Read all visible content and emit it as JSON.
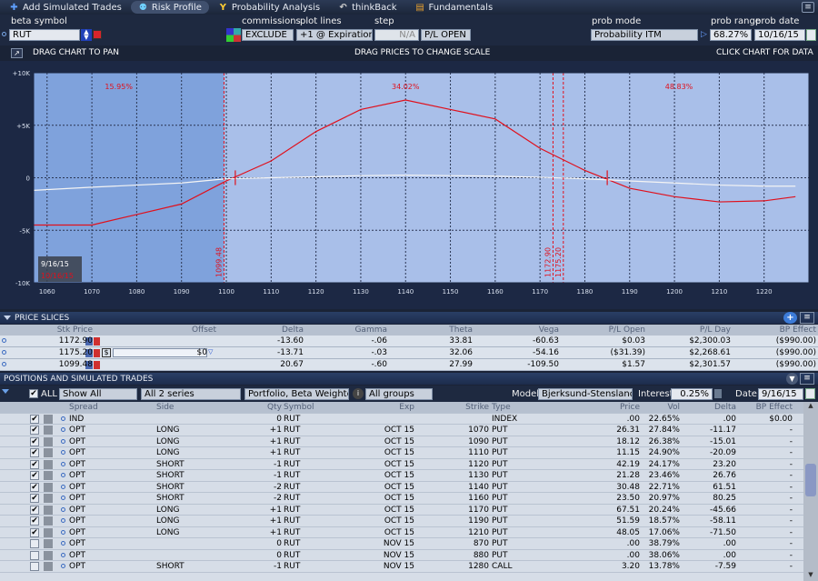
{
  "toolbar": {
    "tabs": [
      {
        "label": "Add Simulated Trades",
        "icon": "plus-icon"
      },
      {
        "label": "Risk Profile",
        "icon": "people-icon",
        "active": true
      },
      {
        "label": "Probability Analysis",
        "icon": "y-icon"
      },
      {
        "label": "thinkBack",
        "icon": "thinkback-icon"
      },
      {
        "label": "Fundamentals",
        "icon": "fundamentals-icon"
      }
    ]
  },
  "controls": {
    "beta_symbol_label": "beta symbol",
    "beta_symbol_value": "RUT",
    "commissions_label": "commissions",
    "commissions_value": "EXCLUDE",
    "plot_lines_label": "plot lines",
    "plot_lines_value": "+1 @ Expiration",
    "step_label": "step",
    "step_value": "N/A",
    "step_mode": "P/L OPEN",
    "prob_mode_label": "prob mode",
    "prob_mode_value": "Probability ITM",
    "prob_range_label": "prob range",
    "prob_range_value": "68.27%",
    "prob_date_label": "prob date",
    "prob_date_value": "10/16/15"
  },
  "chart_header": {
    "left": "DRAG CHART TO PAN",
    "center": "DRAG PRICES TO CHANGE SCALE",
    "right": "CLICK CHART FOR DATA"
  },
  "chart_data": {
    "type": "line",
    "x_ticks": [
      1060,
      1070,
      1080,
      1090,
      1100,
      1110,
      1120,
      1130,
      1140,
      1150,
      1160,
      1170,
      1180,
      1190,
      1200,
      1210,
      1220
    ],
    "y_ticks": [
      "+10K",
      "+5K",
      "0",
      "-5K",
      "-10K"
    ],
    "xlim": [
      1057,
      1230
    ],
    "ylim": [
      -10000,
      10000
    ],
    "series": [
      {
        "name": "",
        "color": "#e0101c",
        "x": [
          1057,
          1070,
          1080,
          1090,
          1100,
          1110,
          1120,
          1130,
          1140,
          1150,
          1160,
          1170,
          1180,
          1190,
          1200,
          1210,
          1220,
          1227
        ],
        "y": [
          -4500,
          -4500,
          -3500,
          -2500,
          -300,
          1600,
          4400,
          6500,
          7400,
          6500,
          5600,
          2800,
          700,
          -1000,
          -1800,
          -2300,
          -2200,
          -1800
        ]
      },
      {
        "name": "",
        "color": "#f4f4f4",
        "x": [
          1057,
          1070,
          1080,
          1090,
          1100,
          1110,
          1120,
          1130,
          1140,
          1150,
          1160,
          1170,
          1180,
          1190,
          1200,
          1210,
          1220,
          1227
        ],
        "y": [
          -1200,
          -900,
          -700,
          -500,
          -100,
          0,
          100,
          200,
          250,
          200,
          150,
          50,
          -100,
          -300,
          -500,
          -700,
          -800,
          -800
        ]
      }
    ],
    "prob_labels": [
      "15.95%",
      "34.02%",
      "48.83%"
    ],
    "vlines": [
      {
        "x": 1099.48,
        "label": "1099.48"
      },
      {
        "x": 1172.9,
        "label": "1172.90"
      },
      {
        "x": 1175.2,
        "label": "1175.20"
      }
    ],
    "shaded_x_max": 1099.48,
    "date_label_1": "9/16/15",
    "date_label_2": "10/16/15"
  },
  "price_slices": {
    "title": "PRICE SLICES",
    "columns": [
      "Stk Price",
      "Offset",
      "Delta",
      "Gamma",
      "Theta",
      "Vega",
      "P/L Open",
      "P/L Day",
      "BP Effect"
    ],
    "rows": [
      [
        "1172.90",
        "",
        "-13.60",
        "-.06",
        "33.81",
        "-60.63",
        "$0.03",
        "$2,300.03",
        "($990.00)"
      ],
      [
        "1175.20",
        "$0",
        "-13.71",
        "-.03",
        "32.06",
        "-54.16",
        "($31.39)",
        "$2,268.61",
        "($990.00)"
      ],
      [
        "1099.48",
        "",
        "20.67",
        "-.60",
        "27.99",
        "-109.50",
        "$1.57",
        "$2,301.57",
        "($990.00)"
      ]
    ]
  },
  "positions": {
    "title": "POSITIONS AND SIMULATED TRADES",
    "all_label": "ALL",
    "show_filter": "Show All",
    "series_filter": "All 2 series",
    "weighting": "Portfolio, Beta Weighted",
    "groups": "All groups",
    "model_label": "Model",
    "model_value": "Bjerksund-Stensland",
    "interest_label": "Interest",
    "interest_value": "0.25%",
    "date_label": "Date",
    "date_value": "9/16/15",
    "columns": [
      "Spread",
      "Side",
      "Qty",
      "Symbol",
      "Exp",
      "Strike",
      "Type",
      "Price",
      "Vol",
      "Delta",
      "BP Effect"
    ],
    "rows": [
      {
        "checked": true,
        "spread": "IND",
        "side": "",
        "qty": "0",
        "sym": "RUT",
        "exp": "",
        "strike": "",
        "type": "INDEX",
        "price": ".00",
        "vol": "22.65%",
        "delta": ".00",
        "bp": "$0.00"
      },
      {
        "checked": true,
        "spread": "OPT",
        "side": "LONG",
        "qty": "+1",
        "sym": "RUT",
        "exp": "OCT 15",
        "strike": "1070",
        "type": "PUT",
        "price": "26.31",
        "vol": "27.84%",
        "delta": "-11.17",
        "bp": "-"
      },
      {
        "checked": true,
        "spread": "OPT",
        "side": "LONG",
        "qty": "+1",
        "sym": "RUT",
        "exp": "OCT 15",
        "strike": "1090",
        "type": "PUT",
        "price": "18.12",
        "vol": "26.38%",
        "delta": "-15.01",
        "bp": "-"
      },
      {
        "checked": true,
        "spread": "OPT",
        "side": "LONG",
        "qty": "+1",
        "sym": "RUT",
        "exp": "OCT 15",
        "strike": "1110",
        "type": "PUT",
        "price": "11.15",
        "vol": "24.90%",
        "delta": "-20.09",
        "bp": "-"
      },
      {
        "checked": true,
        "spread": "OPT",
        "side": "SHORT",
        "qty": "-1",
        "sym": "RUT",
        "exp": "OCT 15",
        "strike": "1120",
        "type": "PUT",
        "price": "42.19",
        "vol": "24.17%",
        "delta": "23.20",
        "bp": "-"
      },
      {
        "checked": true,
        "spread": "OPT",
        "side": "SHORT",
        "qty": "-1",
        "sym": "RUT",
        "exp": "OCT 15",
        "strike": "1130",
        "type": "PUT",
        "price": "21.28",
        "vol": "23.46%",
        "delta": "26.76",
        "bp": "-"
      },
      {
        "checked": true,
        "spread": "OPT",
        "side": "SHORT",
        "qty": "-2",
        "sym": "RUT",
        "exp": "OCT 15",
        "strike": "1140",
        "type": "PUT",
        "price": "30.48",
        "vol": "22.71%",
        "delta": "61.51",
        "bp": "-"
      },
      {
        "checked": true,
        "spread": "OPT",
        "side": "SHORT",
        "qty": "-2",
        "sym": "RUT",
        "exp": "OCT 15",
        "strike": "1160",
        "type": "PUT",
        "price": "23.50",
        "vol": "20.97%",
        "delta": "80.25",
        "bp": "-"
      },
      {
        "checked": true,
        "spread": "OPT",
        "side": "LONG",
        "qty": "+1",
        "sym": "RUT",
        "exp": "OCT 15",
        "strike": "1170",
        "type": "PUT",
        "price": "67.51",
        "vol": "20.24%",
        "delta": "-45.66",
        "bp": "-"
      },
      {
        "checked": true,
        "spread": "OPT",
        "side": "LONG",
        "qty": "+1",
        "sym": "RUT",
        "exp": "OCT 15",
        "strike": "1190",
        "type": "PUT",
        "price": "51.59",
        "vol": "18.57%",
        "delta": "-58.11",
        "bp": "-"
      },
      {
        "checked": true,
        "spread": "OPT",
        "side": "LONG",
        "qty": "+1",
        "sym": "RUT",
        "exp": "OCT 15",
        "strike": "1210",
        "type": "PUT",
        "price": "48.05",
        "vol": "17.06%",
        "delta": "-71.50",
        "bp": "-"
      },
      {
        "checked": false,
        "spread": "OPT",
        "side": "",
        "qty": "0",
        "sym": "RUT",
        "exp": "NOV 15",
        "strike": "870",
        "type": "PUT",
        "price": ".00",
        "vol": "38.79%",
        "delta": ".00",
        "bp": "-"
      },
      {
        "checked": false,
        "spread": "OPT",
        "side": "",
        "qty": "0",
        "sym": "RUT",
        "exp": "NOV 15",
        "strike": "880",
        "type": "PUT",
        "price": ".00",
        "vol": "38.06%",
        "delta": ".00",
        "bp": "-"
      },
      {
        "checked": false,
        "spread": "OPT",
        "side": "SHORT",
        "qty": "-1",
        "sym": "RUT",
        "exp": "NOV 15",
        "strike": "1280",
        "type": "CALL",
        "price": "3.20",
        "vol": "13.78%",
        "delta": "-7.59",
        "bp": "-"
      }
    ]
  }
}
